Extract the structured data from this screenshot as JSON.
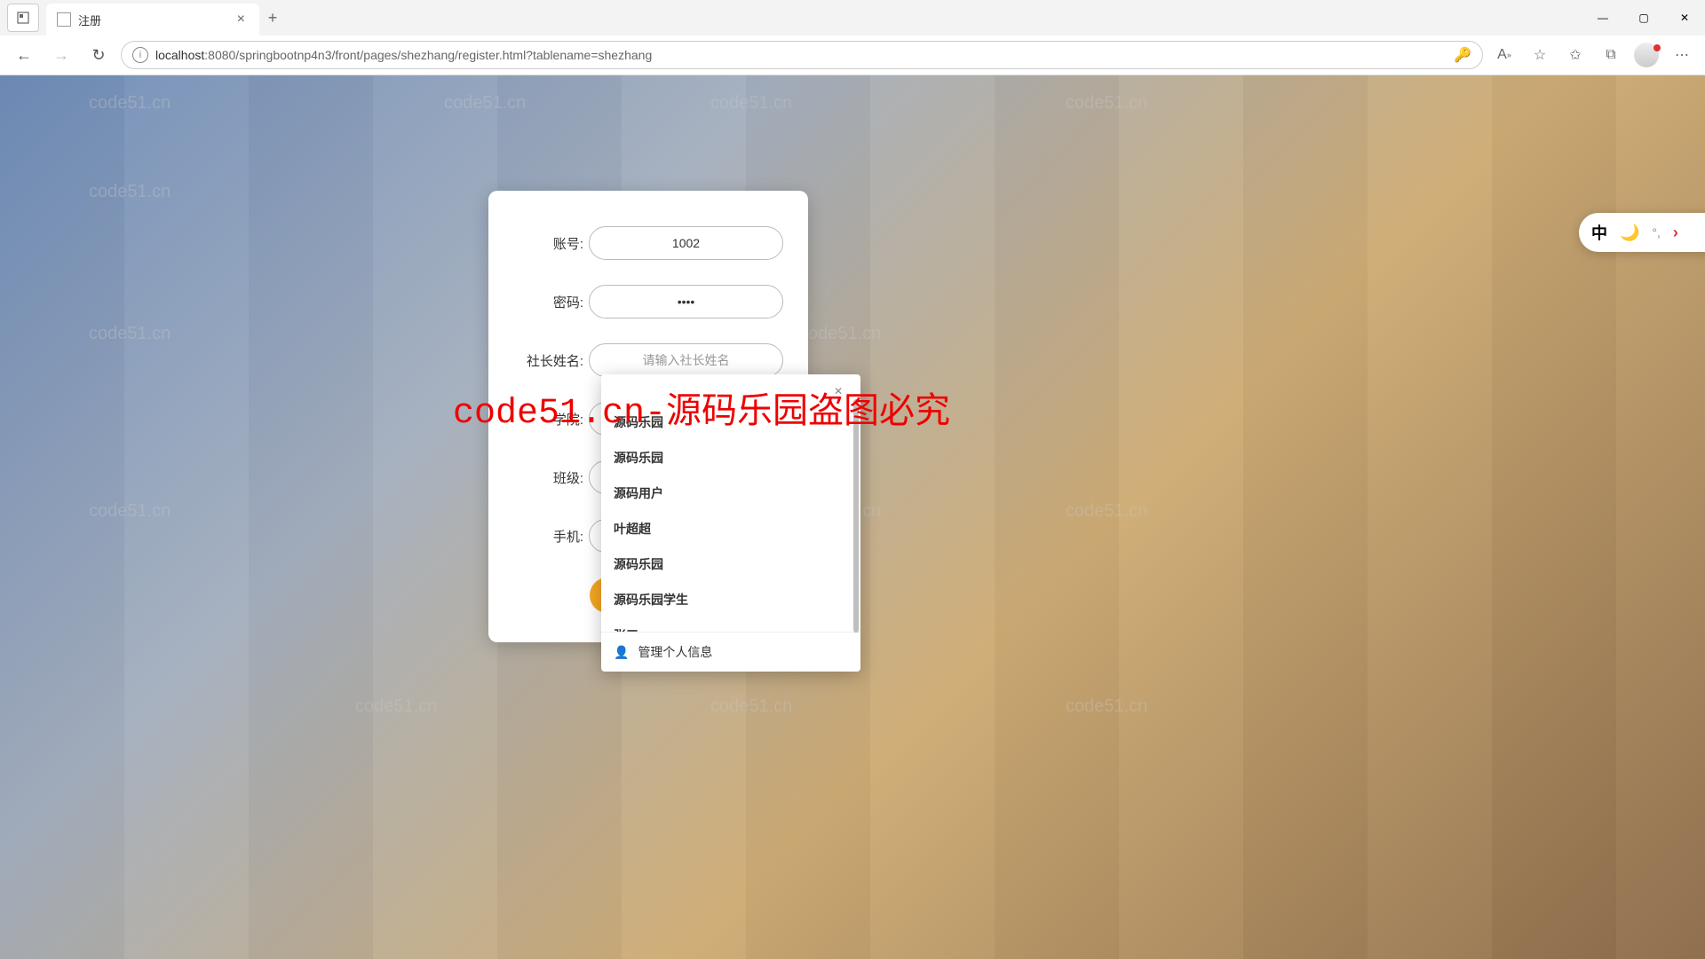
{
  "browser": {
    "tab_title": "注册",
    "url_host": "localhost",
    "url_path": ":8080/springbootnp4n3/front/pages/shezhang/register.html?tablename=shezhang",
    "close_glyph": "×",
    "new_tab_glyph": "+",
    "back_glyph": "←",
    "forward_glyph": "→",
    "reload_glyph": "↻",
    "info_glyph": "i",
    "minimize_glyph": "—",
    "maximize_glyph": "▢",
    "close_window_glyph": "✕",
    "menu_glyph": "⋯"
  },
  "form": {
    "account_label": "账号:",
    "account_value": "1002",
    "password_label": "密码:",
    "password_value": "••••",
    "name_label": "社长姓名:",
    "name_placeholder": "请输入社长姓名",
    "college_label": "学院:",
    "class_label": "班级:",
    "phone_label": "手机:",
    "submit_label": ""
  },
  "autocomplete": {
    "items": [
      "源码乐园",
      "源码乐园",
      "源码用户",
      "叶超超",
      "源码乐园",
      "源码乐园学生",
      "张三"
    ],
    "footer_label": "管理个人信息",
    "close_glyph": "✕",
    "person_glyph": "👤"
  },
  "overlay": {
    "big_text": "code51.cn-源码乐园盗图必究",
    "watermark": "code51.cn"
  },
  "float_pill": {
    "item1": "中",
    "item2": "🌙",
    "item3": "°,",
    "item4": "›"
  }
}
